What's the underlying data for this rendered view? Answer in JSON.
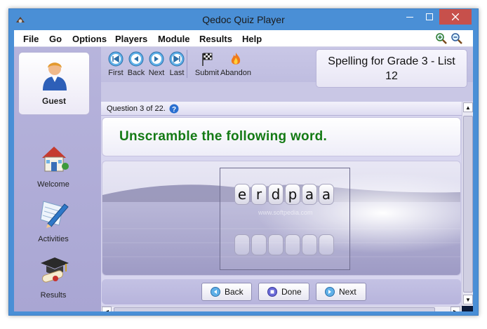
{
  "window": {
    "title": "Qedoc Quiz Player"
  },
  "menu": {
    "file": "File",
    "go": "Go",
    "options": "Options",
    "players": "Players",
    "module": "Module",
    "results": "Results",
    "help": "Help"
  },
  "sidebar": {
    "user": "Guest",
    "items": [
      {
        "label": "Welcome",
        "icon": "house-icon"
      },
      {
        "label": "Activities",
        "icon": "pencil-paper-icon"
      },
      {
        "label": "Results",
        "icon": "graduation-cap-icon"
      }
    ]
  },
  "toolbar": {
    "first": "First",
    "back": "Back",
    "next": "Next",
    "last": "Last",
    "submit": "Submit",
    "abandon": "Abandon"
  },
  "quiz": {
    "title": "Spelling for Grade 3 - List 12",
    "progress": "Question 3 of 22.",
    "instruction": "Unscramble the following word.",
    "scrambled_letters": [
      "e",
      "r",
      "d",
      "p",
      "a",
      "a"
    ],
    "answer_slots": 6,
    "watermark": "www.softpedia.com"
  },
  "buttons": {
    "back": "Back",
    "done": "Done",
    "next": "Next"
  },
  "colors": {
    "instruction": "#147a14",
    "titlebar": "#4a8fd6",
    "close": "#c7504b"
  }
}
